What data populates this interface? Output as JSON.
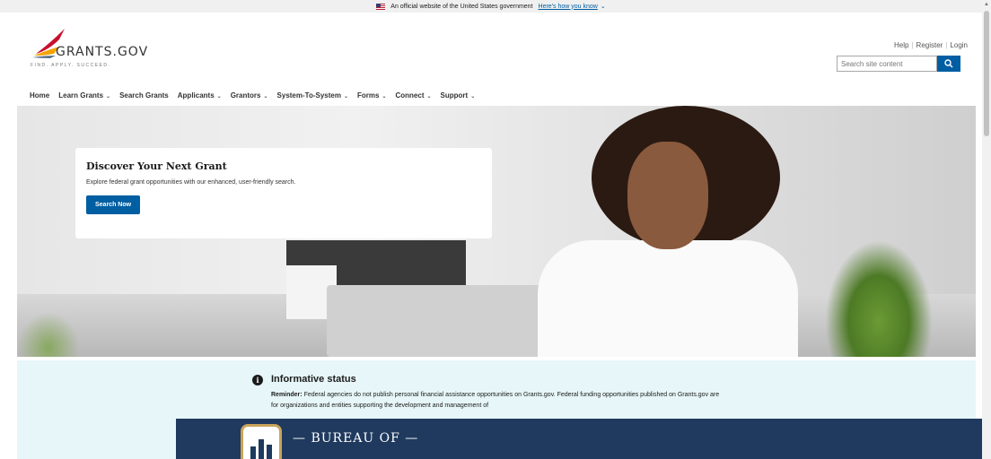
{
  "gov_banner": {
    "text": "An official website of the United States government",
    "link": "Here's how you know"
  },
  "header": {
    "logo_word": "GRANTS.GOV",
    "logo_tagline": "FIND. APPLY. SUCCEED.",
    "links": {
      "help": "Help",
      "register": "Register",
      "login": "Login"
    },
    "search_placeholder": "Search site content"
  },
  "nav": {
    "items": [
      {
        "label": "Home",
        "dropdown": false
      },
      {
        "label": "Learn Grants",
        "dropdown": true
      },
      {
        "label": "Search Grants",
        "dropdown": false
      },
      {
        "label": "Applicants",
        "dropdown": true
      },
      {
        "label": "Grantors",
        "dropdown": true
      },
      {
        "label": "System-To-System",
        "dropdown": true
      },
      {
        "label": "Forms",
        "dropdown": true
      },
      {
        "label": "Connect",
        "dropdown": true
      },
      {
        "label": "Support",
        "dropdown": true
      }
    ]
  },
  "hero": {
    "title": "Discover Your Next Grant",
    "text": "Explore federal grant opportunities with our enhanced, user-friendly search.",
    "button": "Search Now"
  },
  "status": {
    "title": "Informative status",
    "reminder_label": "Reminder:",
    "text": "Federal agencies do not publish personal financial assistance opportunities on Grants.gov. Federal funding opportunities published on Grants.gov are for organizations and entities supporting the development and management of"
  },
  "overlay": {
    "label": "— BUREAU OF —"
  },
  "colors": {
    "primary": "#005ea2",
    "status_bg": "#e7f6f8",
    "overlay_bg": "#1f3a5e"
  }
}
